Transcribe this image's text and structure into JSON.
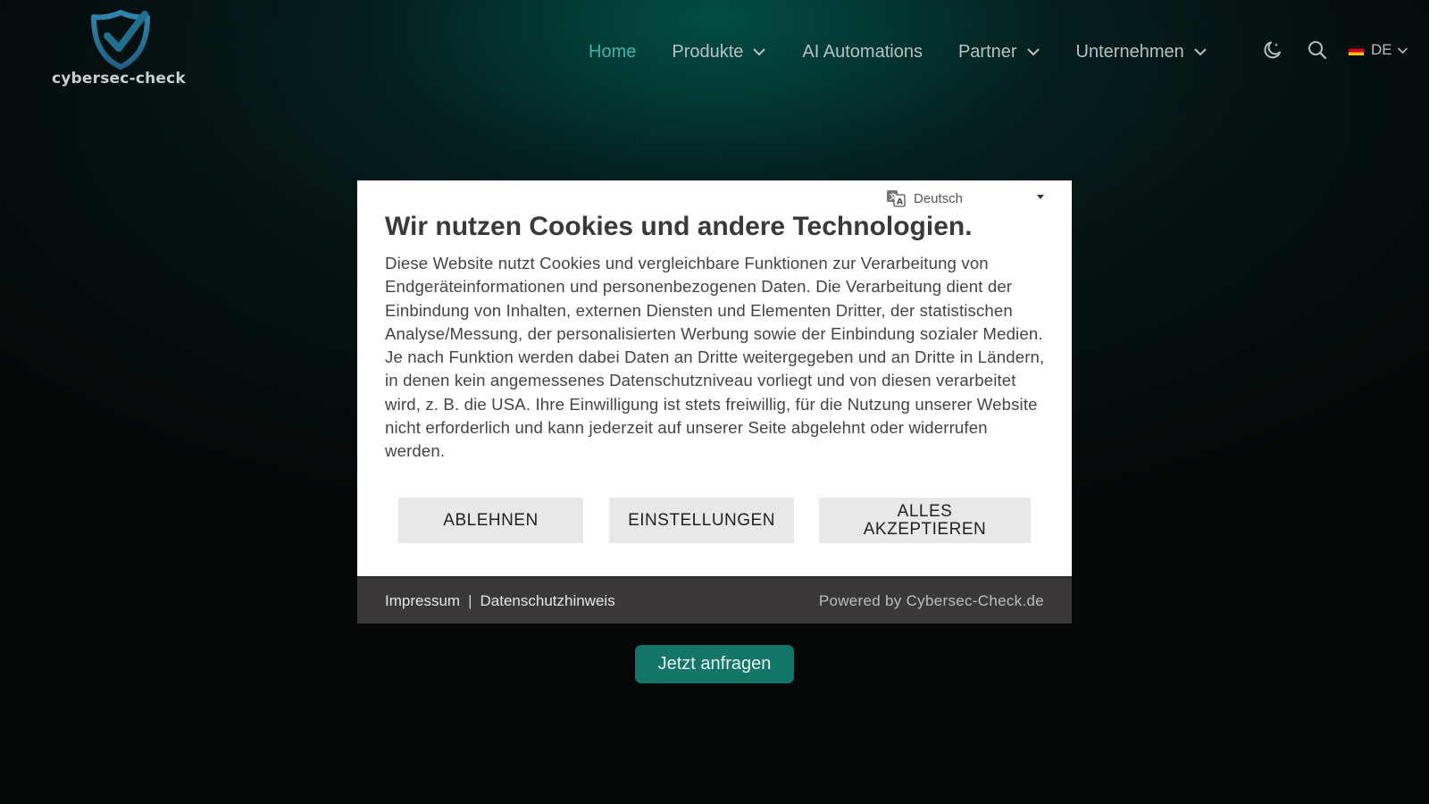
{
  "header": {
    "logo_text": "cybersec-check",
    "nav": [
      {
        "label": "Home",
        "active": true,
        "dropdown": false
      },
      {
        "label": "Produkte",
        "active": false,
        "dropdown": true
      },
      {
        "label": "AI Automations",
        "active": false,
        "dropdown": false
      },
      {
        "label": "Partner",
        "active": false,
        "dropdown": true
      },
      {
        "label": "Unternehmen",
        "active": false,
        "dropdown": true
      }
    ],
    "icons": {
      "theme": "moon-icon",
      "search": "search-icon",
      "flag": "de-flag-icon"
    },
    "language_label": "DE"
  },
  "cta": {
    "label": "Jetzt anfragen"
  },
  "cookie_modal": {
    "language_select": "Deutsch",
    "title": "Wir nutzen Cookies und andere Technologien.",
    "text": "Diese Website nutzt Cookies und vergleichbare Funktionen zur Verarbeitung von Endgeräteinformationen und personenbezogenen Daten. Die Verarbeitung dient der Einbindung von Inhalten, externen Diensten und Elementen Dritter, der statistischen Analyse/Messung, der personalisierten Werbung sowie der Einbindung sozialer Medien. Je nach Funktion werden dabei Daten an Dritte weitergegeben und an Dritte in Ländern, in denen kein angemessenes Datenschutzniveau vorliegt und von diesen verarbeitet wird, z. B. die USA. Ihre Einwilligung ist stets freiwillig, für die Nutzung unserer Website nicht erforderlich und kann jederzeit auf unserer Seite abgelehnt oder widerrufen werden.",
    "buttons": {
      "reject": "ABLEHNEN",
      "settings": "EINSTELLUNGEN",
      "accept": "ALLES AKZEPTIEREN"
    },
    "footer": {
      "imprint": "Impressum",
      "separator": "|",
      "privacy": "Datenschutzhinweis",
      "powered_by": "Powered by Cybersec-Check.de"
    }
  },
  "colors": {
    "accent": "#3fb4a6",
    "cta_bg": "#137567",
    "logo_blue": "#2a6f93",
    "modal_footer_bg": "#3a3838"
  }
}
